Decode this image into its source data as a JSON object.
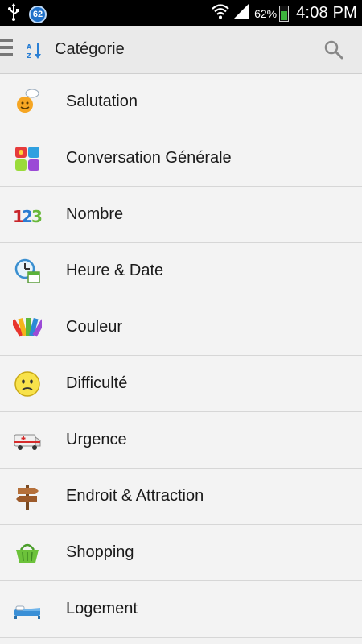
{
  "status_bar": {
    "notification_badge": "62",
    "battery_percent": "62%",
    "time": "4:08 PM"
  },
  "action_bar": {
    "title": "Catégorie"
  },
  "categories": [
    {
      "label": "Salutation",
      "icon": "smiley-wave-icon"
    },
    {
      "label": "Conversation Générale",
      "icon": "blocks-icon"
    },
    {
      "label": "Nombre",
      "icon": "numbers-123-icon"
    },
    {
      "label": "Heure & Date",
      "icon": "clock-calendar-icon"
    },
    {
      "label": "Couleur",
      "icon": "color-swatch-icon"
    },
    {
      "label": "Difficulté",
      "icon": "sad-face-icon"
    },
    {
      "label": "Urgence",
      "icon": "ambulance-icon"
    },
    {
      "label": "Endroit & Attraction",
      "icon": "signpost-icon"
    },
    {
      "label": "Shopping",
      "icon": "shopping-basket-icon"
    },
    {
      "label": "Logement",
      "icon": "bed-icon"
    }
  ],
  "colors": {
    "status_bar_bg": "#000000",
    "action_bar_bg": "#eaeaea",
    "list_bg": "#f3f3f3",
    "divider": "#d6d6d6",
    "badge_blue": "#1e70c9"
  }
}
